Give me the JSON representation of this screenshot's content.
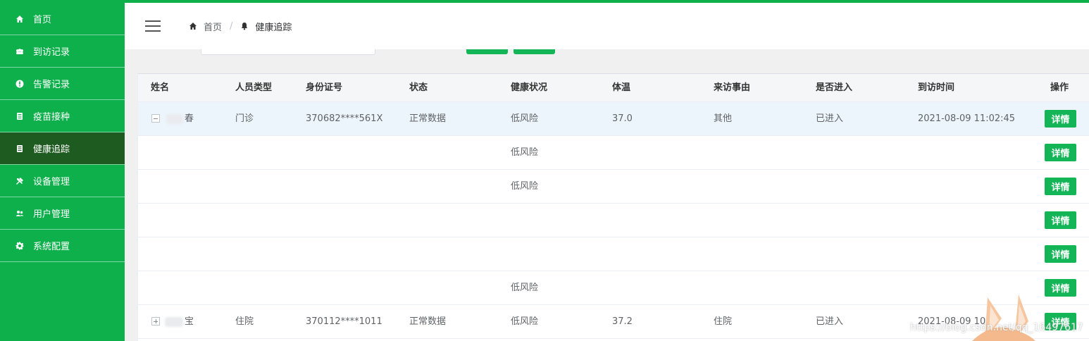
{
  "sidebar": {
    "items": [
      {
        "label": "首页",
        "icon": "home-icon",
        "active": false
      },
      {
        "label": "到访记录",
        "icon": "group-icon",
        "active": false
      },
      {
        "label": "告警记录",
        "icon": "alert-icon",
        "active": false
      },
      {
        "label": "疫苗接种",
        "icon": "document-icon",
        "active": false
      },
      {
        "label": "健康追踪",
        "icon": "document-icon",
        "active": true
      },
      {
        "label": "设备管理",
        "icon": "tools-icon",
        "active": false
      },
      {
        "label": "用户管理",
        "icon": "users-icon",
        "active": false
      },
      {
        "label": "系统配置",
        "icon": "gear-icon",
        "active": false
      }
    ]
  },
  "breadcrumb": {
    "home": "首页",
    "separator": "/",
    "current": "健康追踪"
  },
  "table": {
    "columns": [
      "姓名",
      "人员类型",
      "身份证号",
      "状态",
      "健康状况",
      "体温",
      "来访事由",
      "是否进入",
      "到访时间",
      "操作"
    ],
    "rows": [
      {
        "expand": "collapse",
        "name": "春",
        "type": "门诊",
        "id": "370682****561X",
        "status": "正常数据",
        "health": "低风险",
        "temp": "37.0",
        "reason": "其他",
        "entered": "已进入",
        "time": "2021-08-09 11:02:45",
        "action": "详情"
      },
      {
        "expand": "",
        "name": "",
        "type": "",
        "id": "",
        "status": "",
        "health": "低风险",
        "temp": "",
        "reason": "",
        "entered": "",
        "time": "",
        "action": "详情"
      },
      {
        "expand": "",
        "name": "",
        "type": "",
        "id": "",
        "status": "",
        "health": "低风险",
        "temp": "",
        "reason": "",
        "entered": "",
        "time": "",
        "action": "详情"
      },
      {
        "expand": "",
        "name": "",
        "type": "",
        "id": "",
        "status": "",
        "health": "",
        "temp": "",
        "reason": "",
        "entered": "",
        "time": "",
        "action": "详情"
      },
      {
        "expand": "",
        "name": "",
        "type": "",
        "id": "",
        "status": "",
        "health": "",
        "temp": "",
        "reason": "",
        "entered": "",
        "time": "",
        "action": "详情"
      },
      {
        "expand": "",
        "name": "",
        "type": "",
        "id": "",
        "status": "",
        "health": "低风险",
        "temp": "",
        "reason": "",
        "entered": "",
        "time": "",
        "action": "详情"
      },
      {
        "expand": "expand",
        "name": "宝",
        "type": "住院",
        "id": "370112****1011",
        "status": "正常数据",
        "health": "低风险",
        "temp": "37.2",
        "reason": "住院",
        "entered": "已进入",
        "time": "2021-08-09 10:",
        "action": "详情"
      }
    ]
  },
  "watermark": "https://blog.csdn.net/qq_16497617",
  "colors": {
    "brand": "#0db04b",
    "active_nav": "#1e5b20",
    "button": "#13b557"
  }
}
